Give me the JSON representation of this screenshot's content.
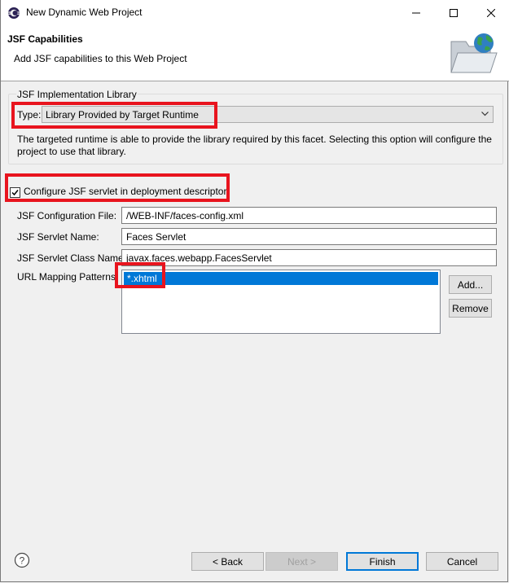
{
  "window": {
    "title": "New Dynamic Web Project"
  },
  "banner": {
    "title": "JSF Capabilities",
    "description": "Add JSF capabilities to this Web Project"
  },
  "implementation": {
    "group_label": "JSF Implementation Library",
    "type_label": "Type:",
    "type_value": "Library Provided by Target Runtime",
    "description": "The targeted runtime is able to provide the library required by this facet. Selecting this option will configure the project to use that library."
  },
  "servlet": {
    "configure_label": "Configure JSF servlet in deployment descriptor",
    "configure_checked": true,
    "config_file_label": "JSF Configuration File:",
    "config_file_value": "/WEB-INF/faces-config.xml",
    "servlet_name_label": "JSF Servlet Name:",
    "servlet_name_value": "Faces Servlet",
    "servlet_class_label": "JSF Servlet Class Name:",
    "servlet_class_value": "javax.faces.webapp.FacesServlet",
    "url_patterns_label": "URL Mapping Patterns:",
    "url_patterns": [
      "*.xhtml"
    ],
    "add_button": "Add...",
    "remove_button": "Remove"
  },
  "footer": {
    "back_button": "< Back",
    "next_button": "Next >",
    "finish_button": "Finish",
    "cancel_button": "Cancel"
  },
  "icons": {
    "app": "eclipse-icon",
    "banner": "folder-globe-icon",
    "help": "help-icon"
  },
  "colors": {
    "highlight": "#e8141e",
    "selection": "#0078d7",
    "default_button_border": "#0078d7"
  }
}
